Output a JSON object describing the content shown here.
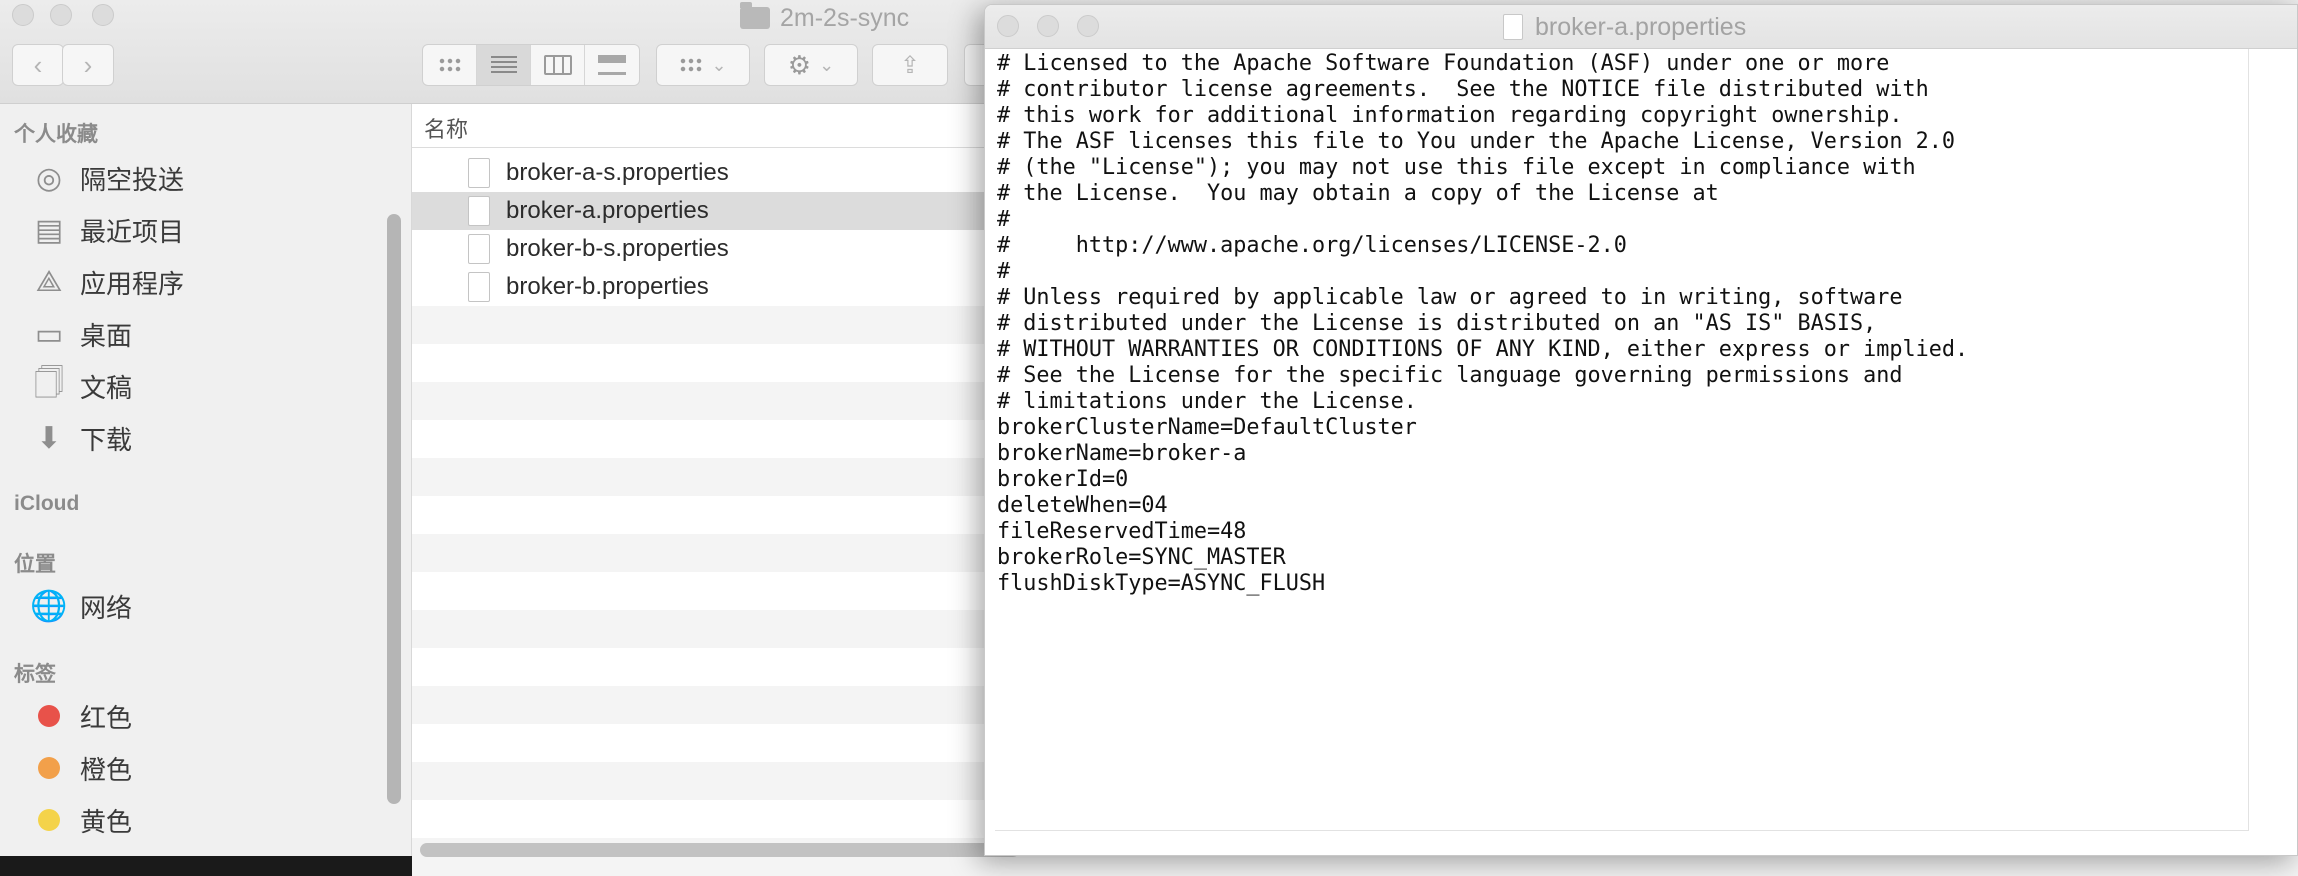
{
  "finder": {
    "title": "2m-2s-sync",
    "sidebar": {
      "favorites_header": "个人收藏",
      "favorites": [
        {
          "label": "隔空投送",
          "icon": "airdrop-icon"
        },
        {
          "label": "最近项目",
          "icon": "recents-icon"
        },
        {
          "label": "应用程序",
          "icon": "applications-icon"
        },
        {
          "label": "桌面",
          "icon": "desktop-icon"
        },
        {
          "label": "文稿",
          "icon": "documents-icon"
        },
        {
          "label": "下载",
          "icon": "downloads-icon"
        }
      ],
      "icloud_header": "iCloud",
      "locations_header": "位置",
      "locations": [
        {
          "label": "网络",
          "icon": "network-icon"
        }
      ],
      "tags_header": "标签",
      "tags": [
        {
          "label": "红色",
          "color": "#e8524a"
        },
        {
          "label": "橙色",
          "color": "#f2a04a"
        },
        {
          "label": "黄色",
          "color": "#f4d34a"
        }
      ]
    },
    "list": {
      "column_name": "名称",
      "files": [
        {
          "name": "broker-a-s.properties",
          "selected": false
        },
        {
          "name": "broker-a.properties",
          "selected": true
        },
        {
          "name": "broker-b-s.properties",
          "selected": false
        },
        {
          "name": "broker-b.properties",
          "selected": false
        }
      ]
    }
  },
  "textedit": {
    "title": "broker-a.properties",
    "lines": [
      "# Licensed to the Apache Software Foundation (ASF) under one or more",
      "# contributor license agreements.  See the NOTICE file distributed with",
      "# this work for additional information regarding copyright ownership.",
      "# The ASF licenses this file to You under the Apache License, Version 2.0",
      "# (the \"License\"); you may not use this file except in compliance with",
      "# the License.  You may obtain a copy of the License at",
      "#",
      "#     http://www.apache.org/licenses/LICENSE-2.0",
      "#",
      "# Unless required by applicable law or agreed to in writing, software",
      "# distributed under the License is distributed on an \"AS IS\" BASIS,",
      "# WITHOUT WARRANTIES OR CONDITIONS OF ANY KIND, either express or implied.",
      "# See the License for the specific language governing permissions and",
      "# limitations under the License.",
      "brokerClusterName=DefaultCluster",
      "brokerName=broker-a",
      "brokerId=0",
      "deleteWhen=04",
      "fileReservedTime=48",
      "brokerRole=SYNC_MASTER",
      "flushDiskType=ASYNC_FLUSH"
    ]
  }
}
